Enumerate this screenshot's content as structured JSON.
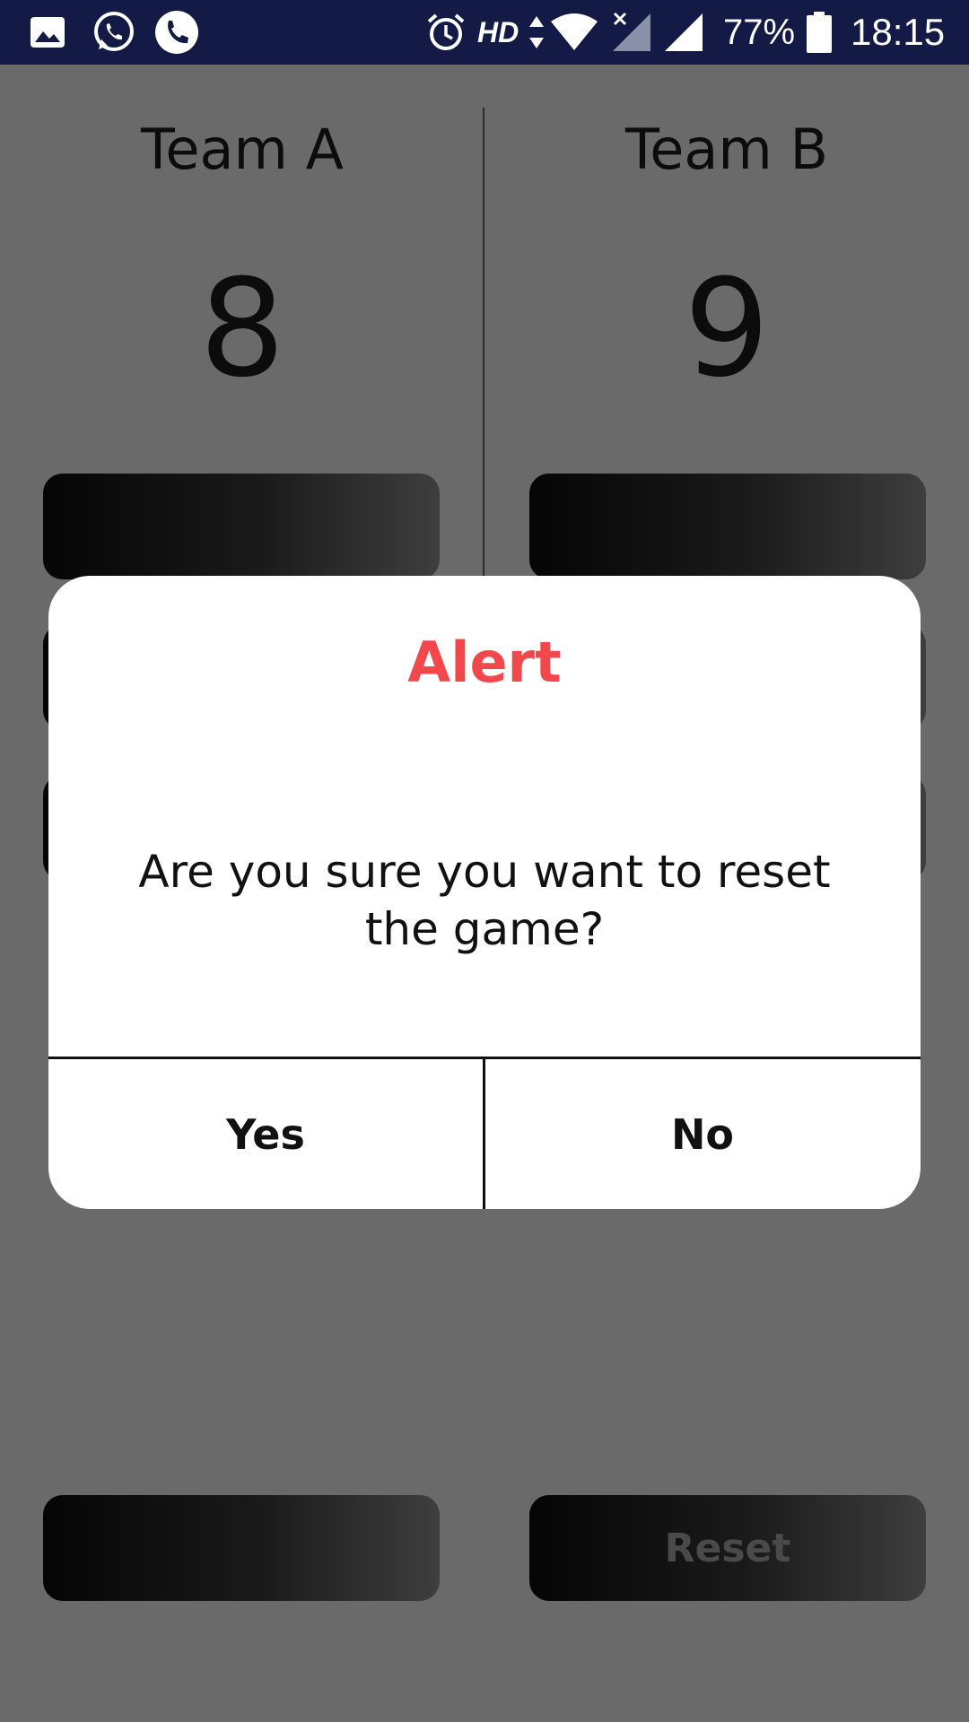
{
  "status_bar": {
    "hd_label": "HD",
    "battery_percent": "77%",
    "time": "18:15",
    "icons": [
      "gallery-icon",
      "whatsapp-icon",
      "phone-icon",
      "alarm-icon",
      "data-arrows-icon",
      "wifi-icon",
      "signal-no-sim-icon",
      "signal-icon",
      "battery-icon"
    ]
  },
  "scoreboard": {
    "team_a": {
      "name": "Team A",
      "score": "8"
    },
    "team_b": {
      "name": "Team B",
      "score": "9"
    },
    "reset_label": "Reset"
  },
  "dialog": {
    "title": "Alert",
    "message": "Are you sure you want to reset the game?",
    "yes_label": "Yes",
    "no_label": "No"
  },
  "colors": {
    "status_bar_bg": "#121a45",
    "overlay_bg": "#6a6a6a",
    "alert_title": "#f2474b",
    "dialog_bg": "#ffffff"
  }
}
